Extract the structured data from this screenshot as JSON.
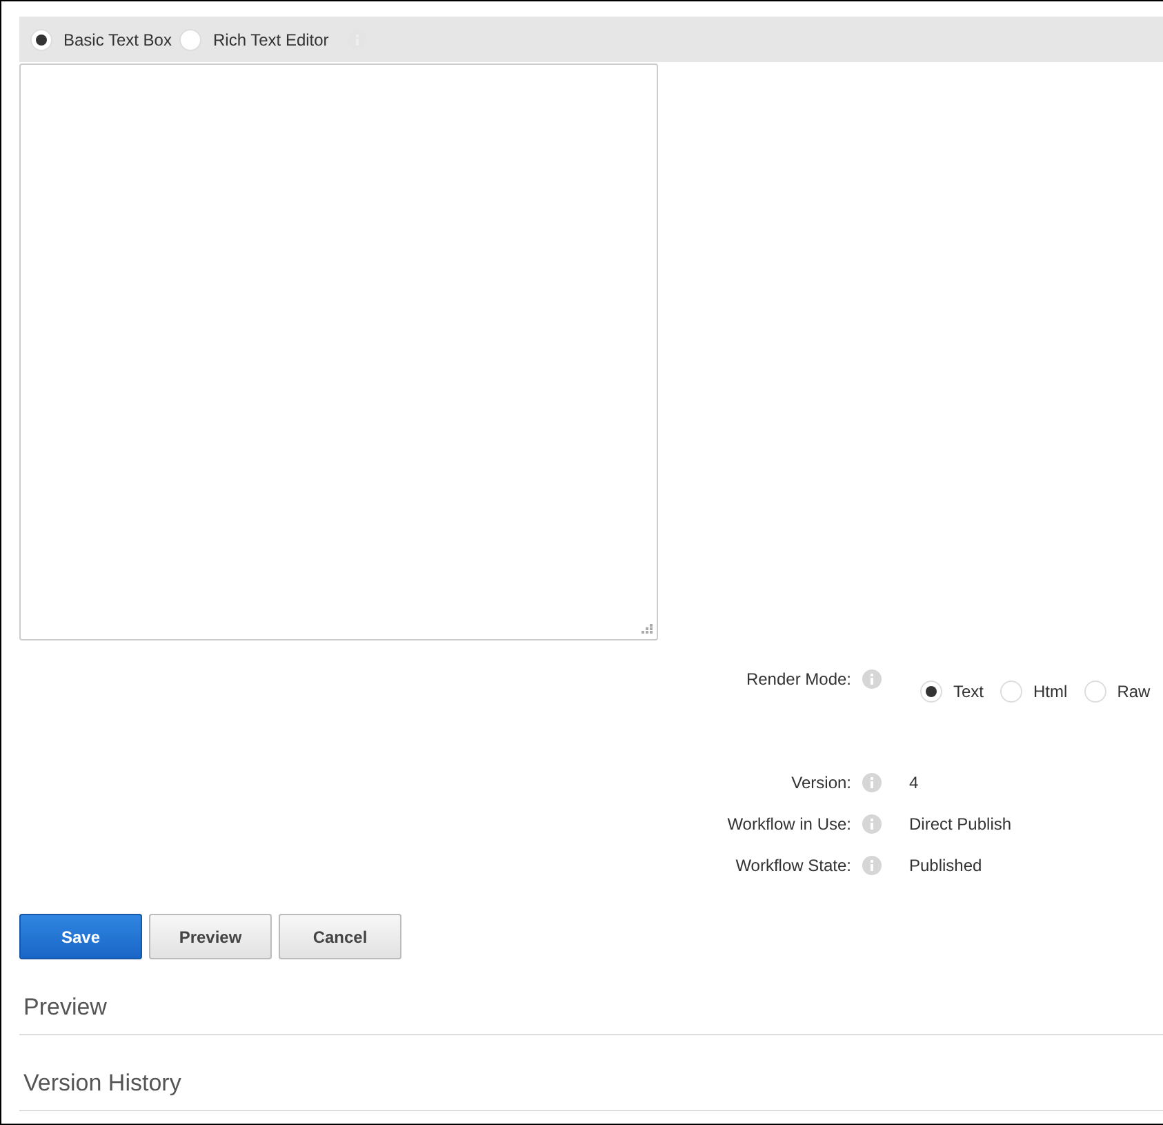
{
  "editor_modes": [
    {
      "label": "Basic Text Box",
      "selected": true
    },
    {
      "label": "Rich Text Editor",
      "selected": false
    }
  ],
  "render_mode": {
    "label": "Render Mode:",
    "options": [
      {
        "label": "Text",
        "selected": true
      },
      {
        "label": "Html",
        "selected": false
      },
      {
        "label": "Raw",
        "selected": false
      }
    ]
  },
  "properties": [
    {
      "label": "Version:",
      "value": "4"
    },
    {
      "label": "Workflow in Use:",
      "value": "Direct Publish"
    },
    {
      "label": "Workflow State:",
      "value": "Published"
    }
  ],
  "buttons": [
    {
      "label": "Save",
      "kind": "primary"
    },
    {
      "label": "Preview",
      "kind": "default"
    },
    {
      "label": "Cancel",
      "kind": "default"
    }
  ],
  "sections": [
    "Preview",
    "Version History"
  ]
}
